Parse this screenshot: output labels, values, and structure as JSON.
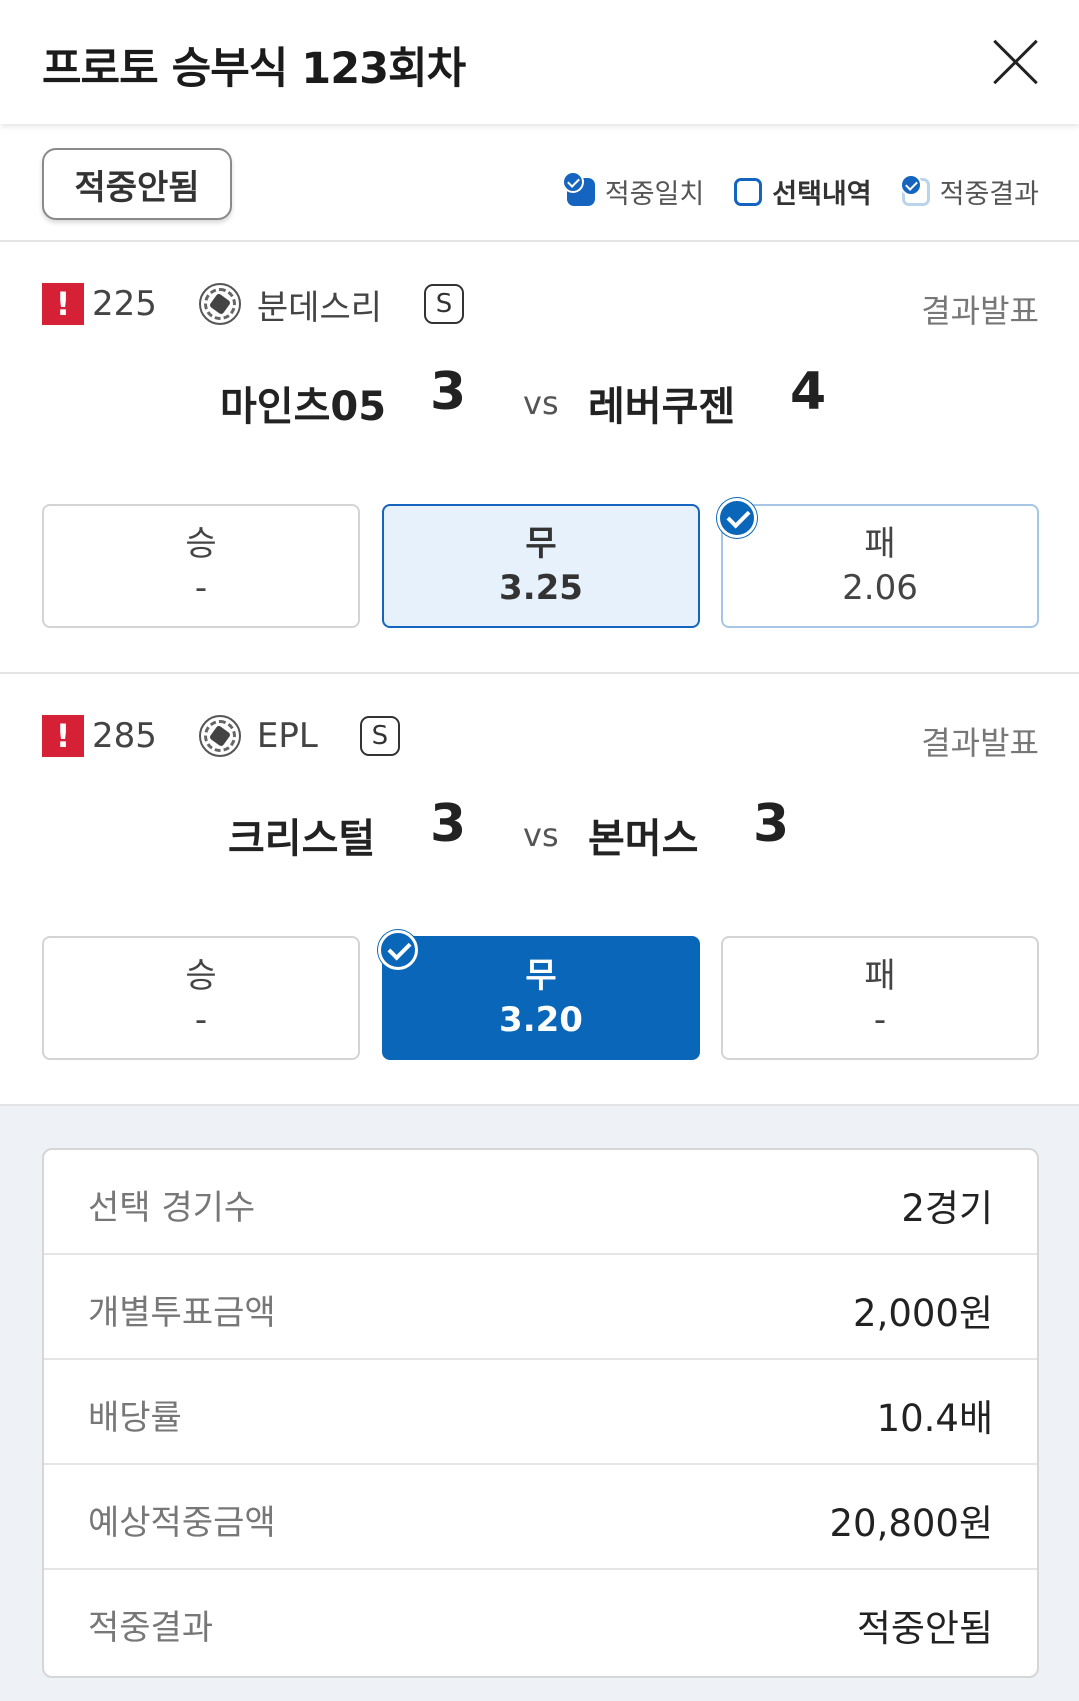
{
  "header": {
    "title": "프로토 승부식 123회차"
  },
  "status": {
    "pill": "적중안됨",
    "legend": [
      {
        "label": "적중일치",
        "icon": "filled-check-box-icon"
      },
      {
        "label": "선택내역",
        "icon": "outline-box-icon"
      },
      {
        "label": "적중결과",
        "icon": "result-check-box-icon"
      }
    ]
  },
  "games": [
    {
      "number": "225",
      "league": "분데스리",
      "badge": "S",
      "result_label": "결과발표",
      "home": "마인츠05",
      "home_score": "3",
      "vs": "vs",
      "away": "레버쿠젠",
      "away_score": "4",
      "options": [
        {
          "label": "승",
          "odds": "-"
        },
        {
          "label": "무",
          "odds": "3.25",
          "state": "selected-outline"
        },
        {
          "label": "패",
          "odds": "2.06",
          "state": "result"
        }
      ]
    },
    {
      "number": "285",
      "league": "EPL",
      "badge": "S",
      "result_label": "결과발표",
      "home": "크리스털",
      "home_score": "3",
      "vs": "vs",
      "away": "본머스",
      "away_score": "3",
      "options": [
        {
          "label": "승",
          "odds": "-"
        },
        {
          "label": "무",
          "odds": "3.20",
          "state": "hit"
        },
        {
          "label": "패",
          "odds": "-"
        }
      ]
    }
  ],
  "summary": [
    {
      "key": "선택 경기수",
      "value": "2경기"
    },
    {
      "key": "개별투표금액",
      "value": "2,000원"
    },
    {
      "key": "배당률",
      "value": "10.4배"
    },
    {
      "key": "예상적중금액",
      "value": "20,800원"
    },
    {
      "key": "적중결과",
      "value": "적중안됨"
    }
  ],
  "colors": {
    "accent": "#0a66b8",
    "warn": "#d62035",
    "summary_bg": "#eef2f7"
  }
}
